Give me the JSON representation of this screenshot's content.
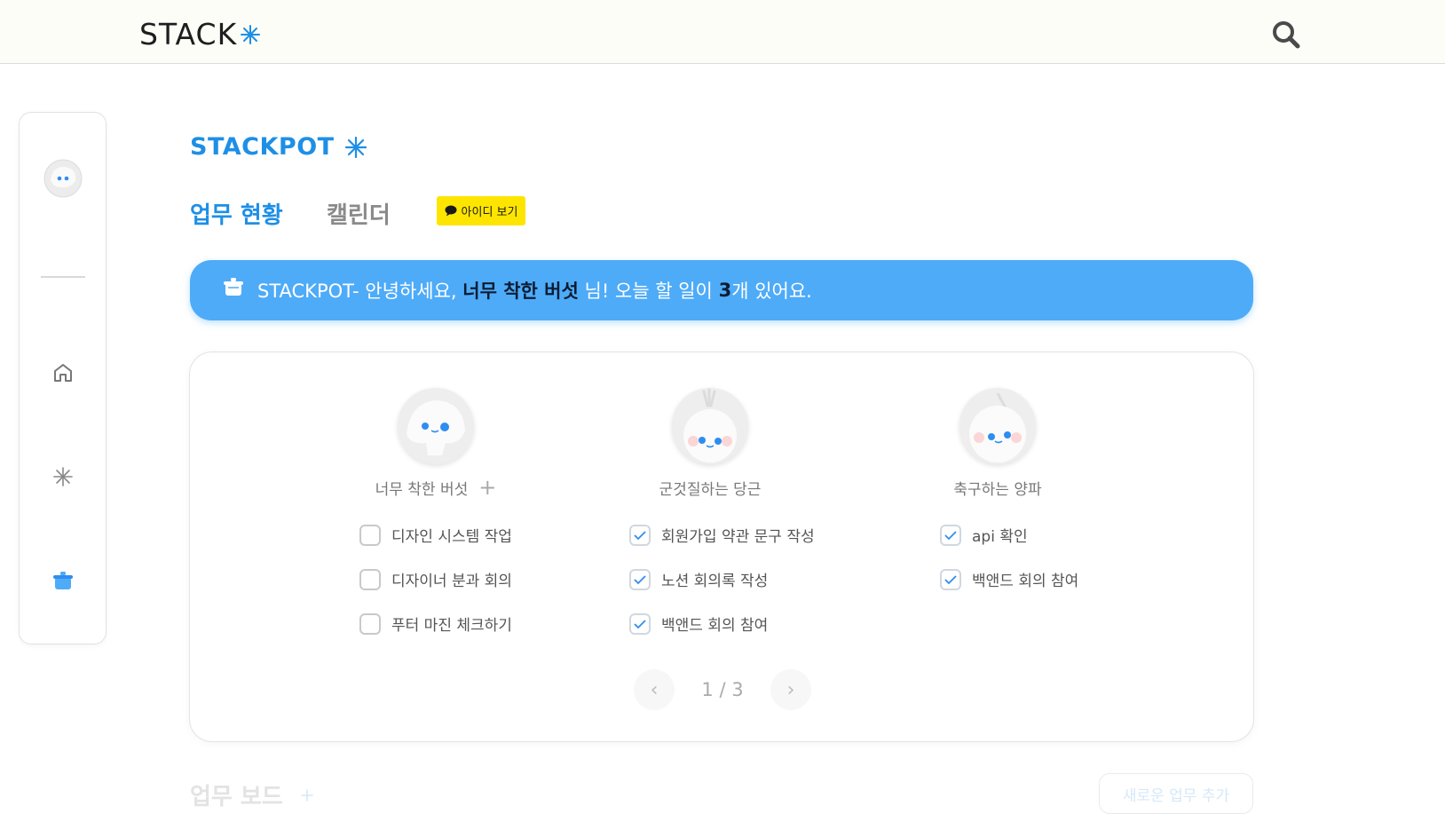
{
  "header": {
    "logo_text": "STACK",
    "logo_icon": "asterisk-icon",
    "search_icon": "search-icon"
  },
  "sidebar": {
    "items": [
      {
        "name": "profile-avatar"
      },
      {
        "name": "home-icon"
      },
      {
        "name": "asterisk-icon"
      },
      {
        "name": "pot-icon",
        "active": true
      }
    ]
  },
  "page": {
    "brand_title": "STACKPOT",
    "tabs": [
      {
        "label": "업무 현황",
        "active": true
      },
      {
        "label": "캘린더",
        "active": false
      }
    ],
    "kakao_button_label": "아이디 보기"
  },
  "banner": {
    "prefix": "STACKPOT- 안녕하세요,",
    "user_name": "너무 착한 버섯",
    "mid": "님! 오늘 할 일이",
    "count": "3",
    "suffix": "개 있어요."
  },
  "members": [
    {
      "name": "너무 착한 버섯",
      "has_add": true,
      "add_label": "+",
      "todos": [
        {
          "text": "디자인 시스템 작업",
          "checked": false
        },
        {
          "text": "디자이너 분과 회의",
          "checked": false
        },
        {
          "text": "푸터 마진 체크하기",
          "checked": false
        }
      ]
    },
    {
      "name": "군것질하는 당근",
      "has_add": false,
      "todos": [
        {
          "text": "회원가입 약관 문구 작성",
          "checked": true
        },
        {
          "text": "노션 회의록 작성",
          "checked": true
        },
        {
          "text": "백앤드 회의 참여",
          "checked": true
        }
      ]
    },
    {
      "name": "축구하는 양파",
      "has_add": false,
      "todos": [
        {
          "text": "api 확인",
          "checked": true
        },
        {
          "text": "백앤드 회의 참여",
          "checked": true
        }
      ]
    }
  ],
  "pagination": {
    "label": "1 / 3",
    "prev": "‹",
    "next": "›"
  },
  "board": {
    "title": "업무 보드",
    "add_button_label": "새로운 업무 추가"
  },
  "colors": {
    "accent": "#1e8fe6",
    "banner": "#4eabf8",
    "kakao": "#fee500"
  }
}
